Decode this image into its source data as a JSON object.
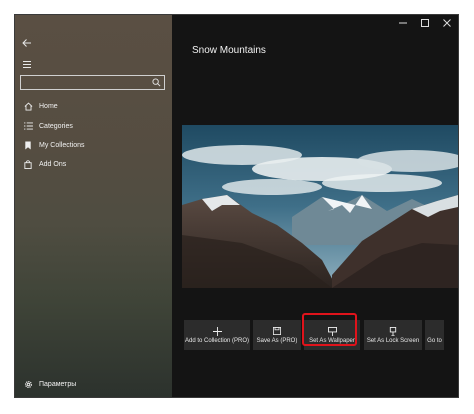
{
  "window": {
    "title_controls": [
      "minimize",
      "maximize",
      "close"
    ]
  },
  "sidebar": {
    "search": {
      "value": "",
      "placeholder": ""
    },
    "items": [
      {
        "label": "Home",
        "icon": "home-icon"
      },
      {
        "label": "Categories",
        "icon": "list-icon"
      },
      {
        "label": "My Collections",
        "icon": "bookmark-icon"
      },
      {
        "label": "Add Ons",
        "icon": "shopping-bag-icon"
      }
    ],
    "settings_label": "Параметры"
  },
  "main": {
    "title": "Snow Mountains",
    "actions": [
      {
        "label": "Add to Collection (PRO)",
        "icon": "plus-icon"
      },
      {
        "label": "Save As (PRO)",
        "icon": "save-icon"
      },
      {
        "label": "Set As Wallpaper",
        "icon": "wallpaper-icon"
      },
      {
        "label": "Set As Lock Screen",
        "icon": "lock-screen-icon"
      },
      {
        "label": "Go to",
        "icon": ""
      }
    ]
  },
  "colors": {
    "highlight": "#e0131b",
    "sidebar_top": "#5a4f43",
    "main_bg": "#141414"
  }
}
